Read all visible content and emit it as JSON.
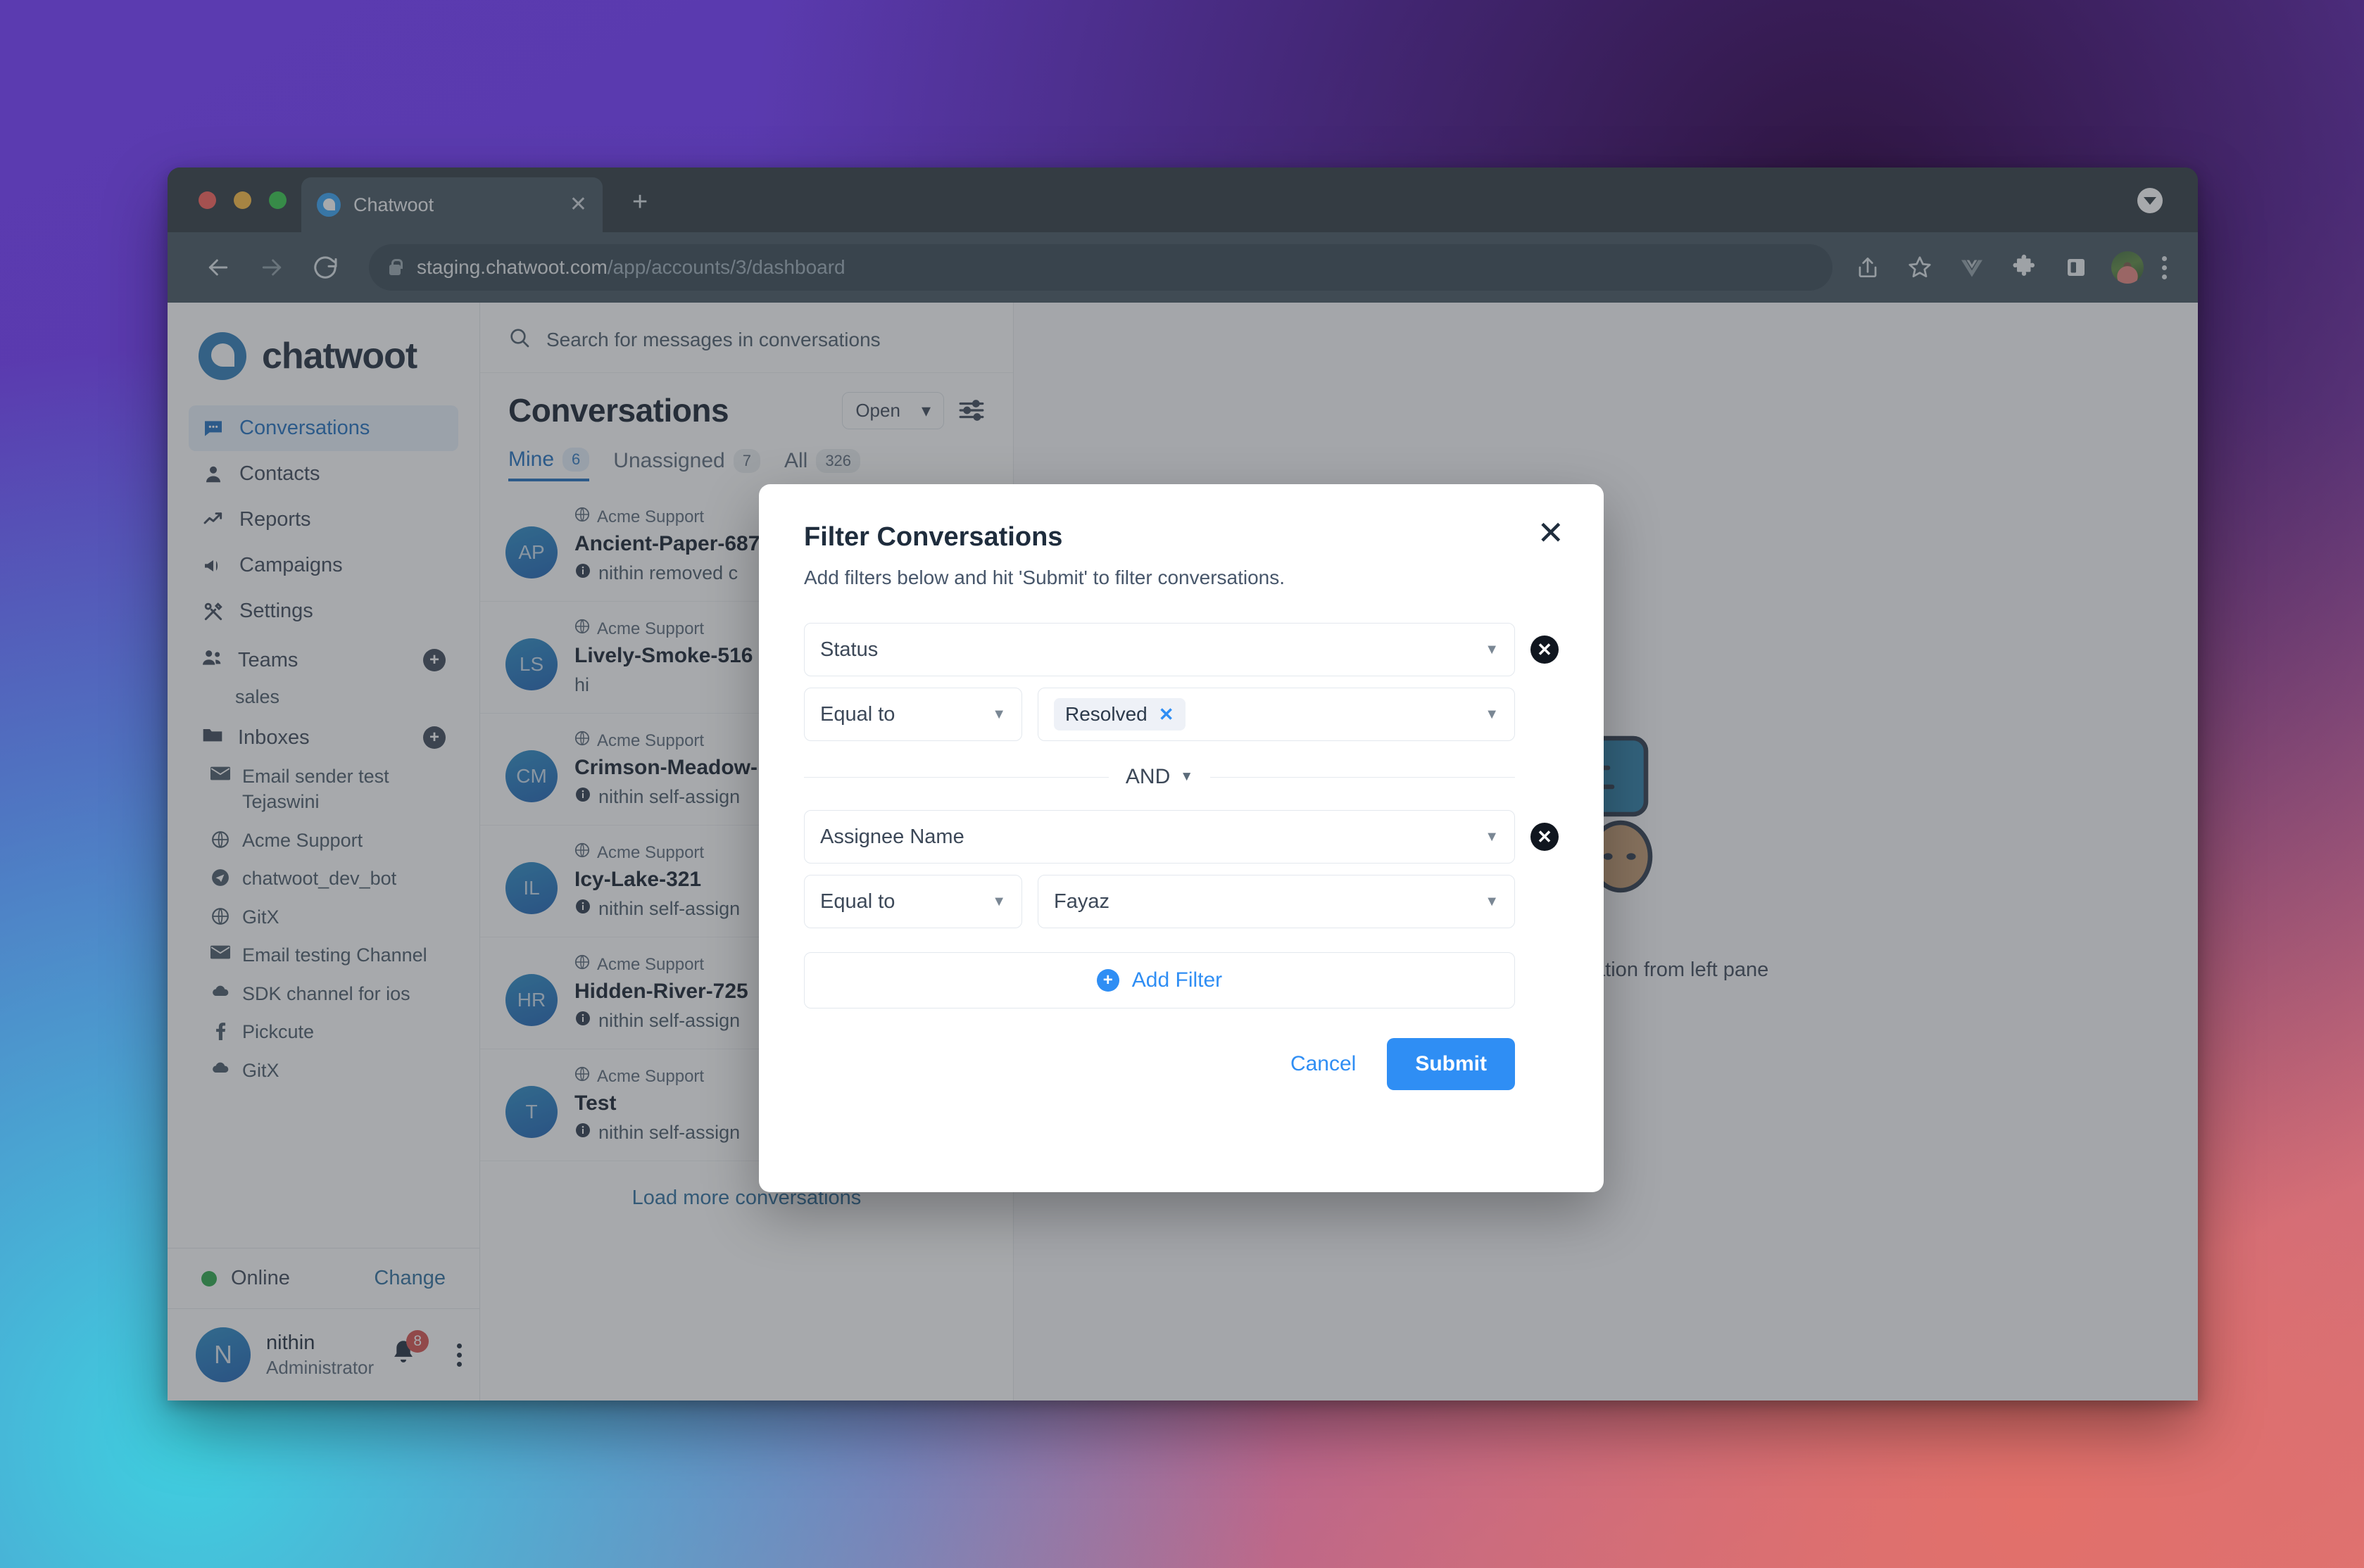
{
  "browser": {
    "tab": {
      "title": "Chatwoot",
      "favicon": "chatwoot-favicon",
      "close": "✕"
    },
    "new_tab": "+",
    "url_domain": "staging.chatwoot.com",
    "url_path": "/app/accounts/3/dashboard",
    "toolbar_icons": [
      "back-icon",
      "forward-icon",
      "reload-icon",
      "share-icon",
      "bookmark-star-icon",
      "vue-devtools-icon",
      "extensions-puzzle-icon",
      "side-panel-icon",
      "profile-avatar",
      "browser-menu-icon"
    ]
  },
  "sidebar": {
    "logo_text": "chatwoot",
    "nav": [
      {
        "label": "Conversations",
        "icon": "chat-bubble-icon",
        "active": true
      },
      {
        "label": "Contacts",
        "icon": "person-icon",
        "active": false
      },
      {
        "label": "Reports",
        "icon": "trending-up-icon",
        "active": false
      },
      {
        "label": "Campaigns",
        "icon": "megaphone-icon",
        "active": false
      },
      {
        "label": "Settings",
        "icon": "tools-icon",
        "active": false
      }
    ],
    "teams": {
      "label": "Teams",
      "icon": "people-icon",
      "add": "+",
      "items": [
        "sales"
      ]
    },
    "inboxes": {
      "label": "Inboxes",
      "icon": "folder-icon",
      "add": "+",
      "items": [
        {
          "label": "Email sender test Tejaswini",
          "icon": "envelope-icon"
        },
        {
          "label": "Acme Support",
          "icon": "globe-icon"
        },
        {
          "label": "chatwoot_dev_bot",
          "icon": "telegram-icon"
        },
        {
          "label": "GitX",
          "icon": "globe-icon"
        },
        {
          "label": "Email testing Channel",
          "icon": "envelope-icon"
        },
        {
          "label": "SDK channel for ios",
          "icon": "cloud-icon"
        },
        {
          "label": "Pickcute",
          "icon": "facebook-icon"
        },
        {
          "label": "GitX",
          "icon": "cloud-icon"
        }
      ]
    },
    "status": {
      "label": "Online",
      "change": "Change",
      "color": "#2ba84a"
    },
    "profile": {
      "initial": "N",
      "name": "nithin",
      "role": "Administrator",
      "notification_count": "8",
      "menu_icon": "kebab-menu-icon"
    }
  },
  "conversations": {
    "search_placeholder": "Search for messages in conversations",
    "title": "Conversations",
    "status_filter": "Open",
    "filter_icon": "sliders-filter-icon",
    "tabs": [
      {
        "label": "Mine",
        "count": "6",
        "active": true
      },
      {
        "label": "Unassigned",
        "count": "7",
        "active": false
      },
      {
        "label": "All",
        "count": "326",
        "active": false
      }
    ],
    "items": [
      {
        "initials": "AP",
        "inbox": "Acme Support",
        "name": "Ancient-Paper-687",
        "message": "nithin removed c"
      },
      {
        "initials": "LS",
        "inbox": "Acme Support",
        "name": "Lively-Smoke-516",
        "message": "hi"
      },
      {
        "initials": "CM",
        "inbox": "Acme Support",
        "name": "Crimson-Meadow-",
        "message": "nithin self-assign"
      },
      {
        "initials": "IL",
        "inbox": "Acme Support",
        "name": "Icy-Lake-321",
        "message": "nithin self-assign"
      },
      {
        "initials": "HR",
        "inbox": "Acme Support",
        "name": "Hidden-River-725",
        "message": "nithin self-assign"
      },
      {
        "initials": "T",
        "inbox": "Acme Support",
        "name": "Test",
        "message": "nithin self-assign"
      }
    ],
    "load_more": "Load more conversations"
  },
  "main": {
    "empty_text": "Select a conversation from left pane",
    "illustration": "empty-chat-illustration"
  },
  "modal": {
    "title": "Filter Conversations",
    "subtitle": "Add filters below and hit 'Submit' to filter conversations.",
    "close_icon": "✕",
    "groups": [
      {
        "attribute": "Status",
        "operator": "Equal to",
        "value_chip": "Resolved",
        "chip_remove": "✕",
        "remove_icon": "✕"
      },
      {
        "attribute": "Assignee Name",
        "operator": "Equal to",
        "value": "Fayaz",
        "remove_icon": "✕"
      }
    ],
    "conjunction": "AND",
    "add_filter": "Add Filter",
    "add_filter_icon": "+",
    "cancel": "Cancel",
    "submit": "Submit",
    "accent_color": "#2f8ef4"
  }
}
